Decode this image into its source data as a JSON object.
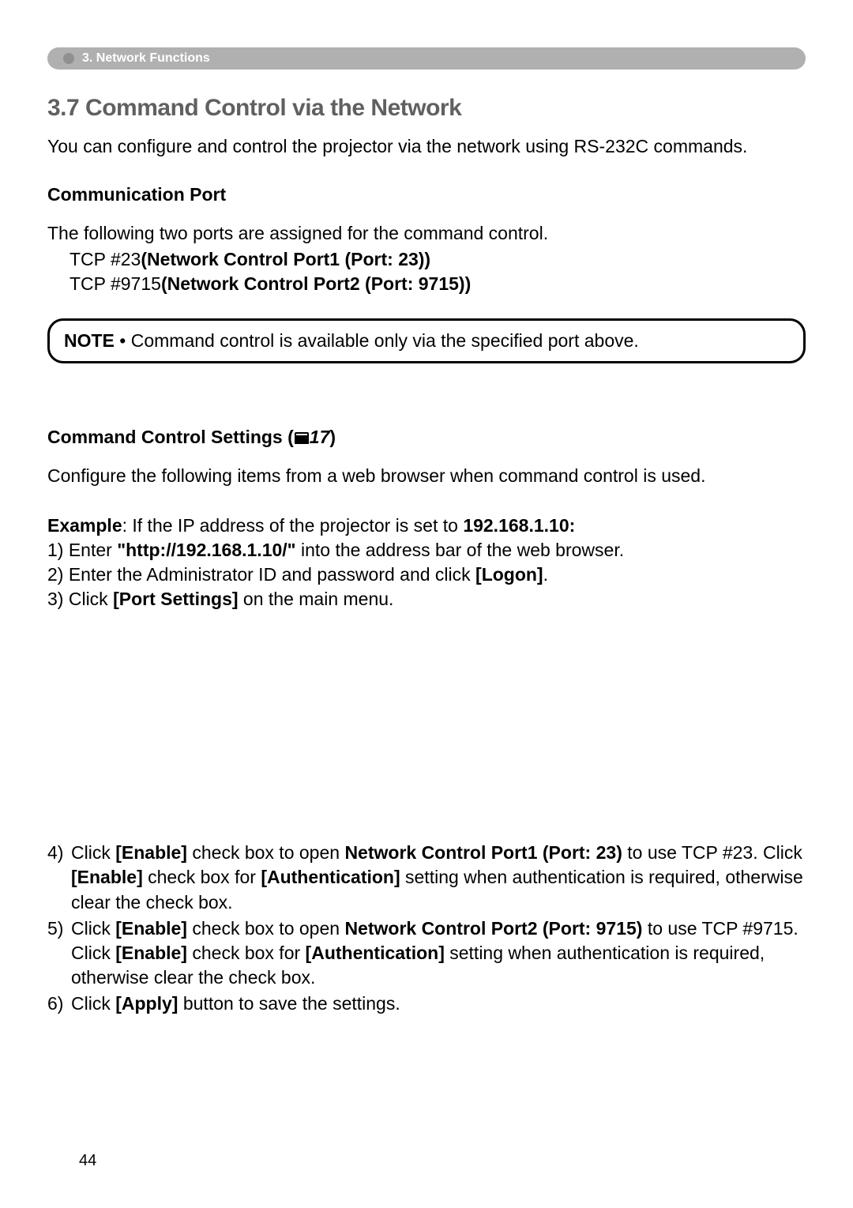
{
  "header": {
    "breadcrumb": "3. Network Functions"
  },
  "section": {
    "title": "3.7 Command Control via the Network",
    "intro": "You can configure and control the projector via the network using RS-232C commands."
  },
  "communicationPort": {
    "title": "Communication Port",
    "intro": "The following two ports are assigned for the command control.",
    "ports": [
      {
        "prefix": "TCP #23",
        "name": "(Network Control Port1 (Port: 23))"
      },
      {
        "prefix": "TCP #9715",
        "name": "(Network Control Port2 (Port: 9715))"
      }
    ]
  },
  "note": {
    "label": "NOTE",
    "text": "• Command control is available only via the specified port above."
  },
  "commandControlSettings": {
    "titlePrefix": "Command Control Settings (",
    "refNum": "17",
    "titleSuffix": ")",
    "intro": "Configure the following items from a web browser when command control is used.",
    "exampleLabel": "Example",
    "exampleText": ": If the IP address of the projector is set to ",
    "exampleIp": "192.168.1.10:",
    "step1": {
      "num": "1)",
      "prefix": "Enter ",
      "url": "\"http://192.168.1.10/\"",
      "suffix": " into the address bar of the web browser."
    },
    "step2": {
      "num": "2)",
      "prefix": "Enter the Administrator ID and password and click ",
      "button": "[Logon]",
      "suffix": "."
    },
    "step3": {
      "num": "3)",
      "prefix": "Click ",
      "button": "[Port Settings]",
      "suffix": " on the main menu."
    },
    "step4": {
      "num": "4)",
      "p1": "Click ",
      "b1": "[Enable]",
      "p2": " check box to open ",
      "b2": "Network Control Port1 (Port: 23)",
      "p3": " to use TCP #23. Click ",
      "b3": "[Enable]",
      "p4": " check box for ",
      "b4": "[Authentication]",
      "p5": " setting when authentication is required, otherwise clear the check box."
    },
    "step5": {
      "num": "5)",
      "p1": "Click ",
      "b1": "[Enable]",
      "p2": " check box to open ",
      "b2": "Network Control Port2 (Port: 9715)",
      "p3": " to use TCP #9715. Click ",
      "b3": "[Enable]",
      "p4": " check box for ",
      "b4": "[Authentication]",
      "p5": " setting when authentication is required, otherwise clear the check box."
    },
    "step6": {
      "num": "6)",
      "prefix": "Click ",
      "button": "[Apply]",
      "suffix": " button to save the settings."
    }
  },
  "pageNumber": "44"
}
